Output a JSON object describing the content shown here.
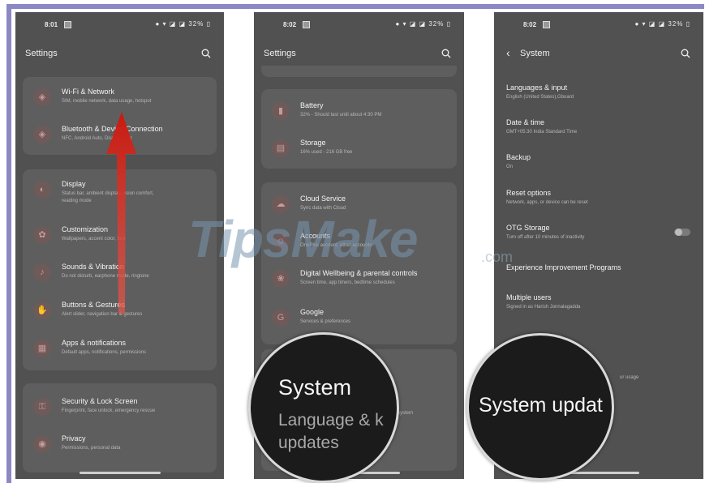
{
  "screen1": {
    "status": {
      "time": "8:01",
      "right": "● ▾ ◪ ◪ 32% ▯"
    },
    "title": "Settings",
    "cards": [
      [
        {
          "label": "Wi-Fi & Network",
          "sub": "SIM, mobile network, data usage, hotspot"
        },
        {
          "label": "Bluetooth & Device Connection",
          "sub": "NFC, Android Auto, Display, cast"
        }
      ],
      [
        {
          "label": "Display",
          "sub": "Status bar, ambient display, vision comfort,",
          "sub2": "reading mode"
        },
        {
          "label": "Customization",
          "sub": "Wallpapers, accent color, font"
        },
        {
          "label": "Sounds & Vibration",
          "sub": "Do not disturb, earphone mode, ringtone"
        },
        {
          "label": "Buttons & Gestures",
          "sub": "Alert slider, navigation bar & gestures"
        },
        {
          "label": "Apps & notifications",
          "sub": "Default apps, notifications, permissions"
        }
      ],
      [
        {
          "label": "Security & Lock Screen",
          "sub": "Fingerprint, face unlock, emergency rescue"
        },
        {
          "label": "Privacy",
          "sub": "Permissions, personal data"
        }
      ]
    ]
  },
  "screen2": {
    "status": {
      "time": "8:02",
      "right": "● ▾ ◪ ◪ 32% ▯"
    },
    "title": "Settings",
    "cards": [
      [
        {
          "label": "Battery",
          "sub": "32% - Should last until about 4:30 PM"
        },
        {
          "label": "Storage",
          "sub": "16% used - 216 GB free"
        }
      ],
      [
        {
          "label": "Cloud Service",
          "sub": "Sync data with Cloud"
        },
        {
          "label": "Accounts",
          "sub": "OnePlus account, other accounts"
        },
        {
          "label": "Digital Wellbeing & parental controls",
          "sub": "Screen time, app timers, bedtime schedules"
        },
        {
          "label": "Google",
          "sub": "Services & preferences"
        }
      ]
    ],
    "partial_texts": [
      "locker",
      "system"
    ]
  },
  "screen3": {
    "status": {
      "time": "8:02",
      "right": "● ▾ ◪ ◪ 32% ▯"
    },
    "title": "System",
    "back": "‹",
    "items": [
      {
        "label": "Languages & input",
        "sub": "English (United States),Gboard"
      },
      {
        "label": "Date & time",
        "sub": "GMT+05:30 India Standard Time"
      },
      {
        "label": "Backup",
        "sub": "On"
      },
      {
        "label": "Reset options",
        "sub": "Network, apps, or device can be reset"
      },
      {
        "label": "OTG Storage",
        "sub": "Turn off after 10 minutes of inactivity",
        "toggle": false
      },
      {
        "label": "Experience Improvement Programs",
        "sub": ""
      },
      {
        "label": "Multiple users",
        "sub": "Signed in as Harish Jonnalagadda"
      }
    ],
    "partial_texts": [
      "ur usage"
    ]
  },
  "magnifier1": {
    "title": "System",
    "sub1": "Language & k",
    "sub2": "updates"
  },
  "magnifier2": {
    "title": "System updat"
  },
  "watermark": {
    "text": "TipsMake",
    "suffix": ".com"
  },
  "colors": {
    "accent_icon": "#6f5a5a",
    "arrow": "#d9261c",
    "frame": "#8c88c4"
  },
  "icons": [
    "search-icon",
    "back-arrow-icon",
    "swipe-up-arrow"
  ]
}
